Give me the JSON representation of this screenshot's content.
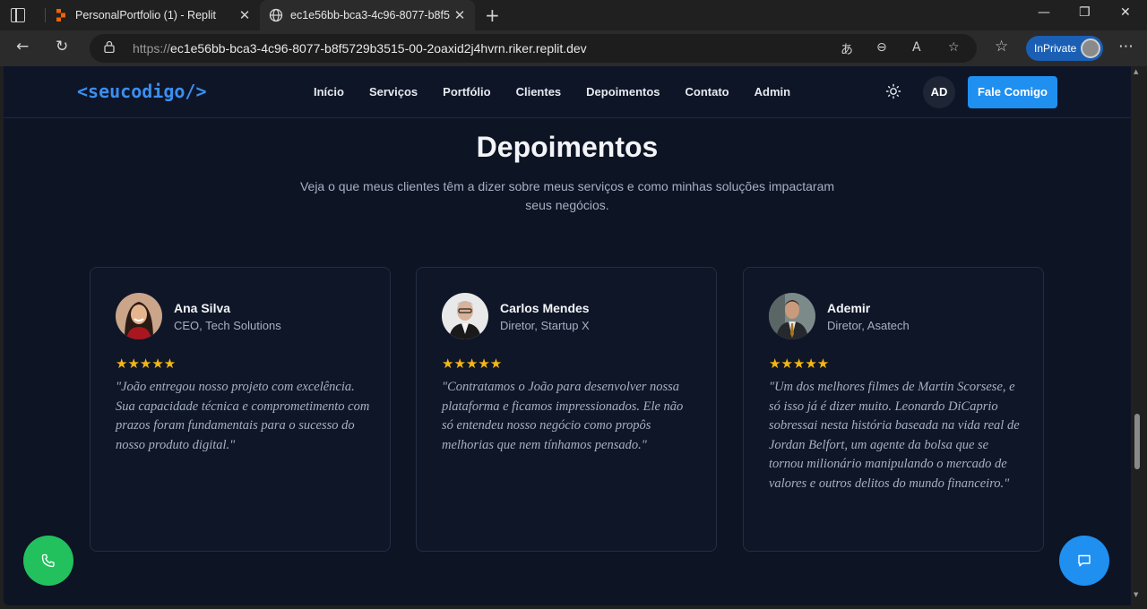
{
  "browser": {
    "tabs": [
      {
        "title": "PersonalPortfolio (1) - Replit",
        "active": false
      },
      {
        "title": "ec1e56bb-bca3-4c96-8077-b8f57",
        "active": true
      }
    ],
    "url_prefix": "https://",
    "url_rest": "ec1e56bb-bca3-4c96-8077-b8f5729b3515-00-2oaxid2j4hvrn.riker.replit.dev",
    "inprivate_label": "InPrivate"
  },
  "site": {
    "logo": "<seucodigo/>",
    "menu": [
      "Início",
      "Serviços",
      "Portfólio",
      "Clientes",
      "Depoimentos",
      "Contato",
      "Admin"
    ],
    "avatar_initials": "AD",
    "cta_label": "Fale Comigo"
  },
  "testimonials": {
    "title": "Depoimentos",
    "subtitle": "Veja o que meus clientes têm a dizer sobre meus serviços e como minhas soluções impactaram seus negócios.",
    "cards": [
      {
        "name": "Ana Silva",
        "role": "CEO, Tech Solutions",
        "stars": "★★★★★",
        "quote": "\"João entregou nosso projeto com excelência. Sua capacidade técnica e comprometimento com prazos foram fundamentais para o sucesso do nosso produto digital.\""
      },
      {
        "name": "Carlos Mendes",
        "role": "Diretor, Startup X",
        "stars": "★★★★★",
        "quote": "\"Contratamos o João para desenvolver nossa plataforma e ficamos impressionados. Ele não só entendeu nosso negócio como propôs melhorias que nem tínhamos pensado.\""
      },
      {
        "name": "Ademir",
        "role": "Diretor, Asatech",
        "stars": "★★★★★",
        "quote": "\"Um dos melhores filmes de Martin Scorsese, e só isso já é dizer muito. Leonardo DiCaprio sobressai nesta história baseada na vida real de Jordan Belfort, um agente da bolsa que se tornou milionário manipulando o mercado de valores e outros delitos do mundo financeiro.\""
      }
    ]
  },
  "colors": {
    "accent": "#1f8ff0",
    "whatsapp": "#22c15e",
    "star": "#f5b70f",
    "page_bg": "#0d1424"
  }
}
